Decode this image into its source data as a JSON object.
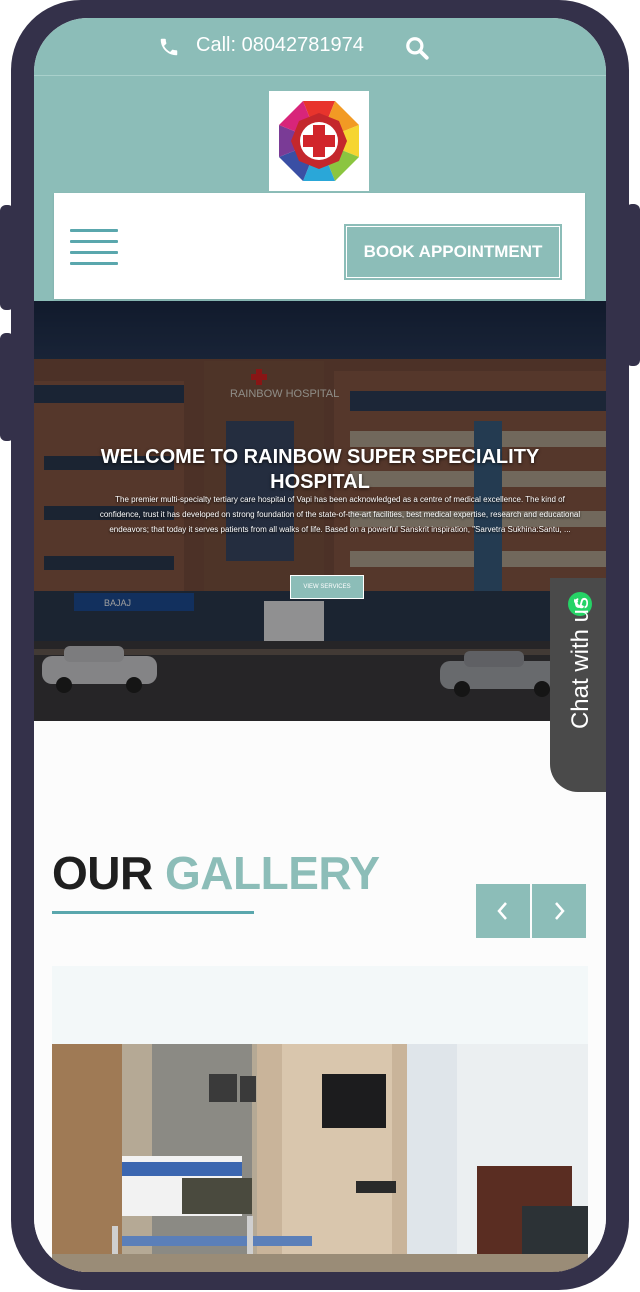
{
  "topbar": {
    "call_label": "Call: 08042781974",
    "icons": [
      "phone-icon",
      "search-icon"
    ]
  },
  "header": {
    "book_button": "BOOK APPOINTMENT",
    "icons": [
      "hamburger-menu-icon"
    ]
  },
  "hero": {
    "title": "WELCOME TO RAINBOW SUPER SPECIALITY HOSPITAL",
    "description": "The premier multi-specialty tertiary care hospital of Vapi has been acknowledged as a centre of medical excellence. The kind of confidence, trust it has developed on strong foundation of the state-of-the-art facilities, best medical expertise, research and educational endeavors; that today it serves patients from all walks of life. Based on a powerful Sanskrit inspiration, \"Sarvetra Sukhina:Santu, ...",
    "button": "VIEW SERVICES",
    "building_sign": "RAINBOW HOSPITAL",
    "store_sign": "BAJAJ"
  },
  "gallery": {
    "title_part1": "OUR",
    "title_part2": "GALLERY",
    "icons": [
      "chevron-left-icon",
      "chevron-right-icon"
    ]
  },
  "chat": {
    "label": "Chat with us",
    "icon": "whatsapp-icon"
  },
  "colors": {
    "brand": "#8cbdb8",
    "accent": "#5aa7ad",
    "frame": "#34314a",
    "chat_tab": "#4a4a4a"
  }
}
